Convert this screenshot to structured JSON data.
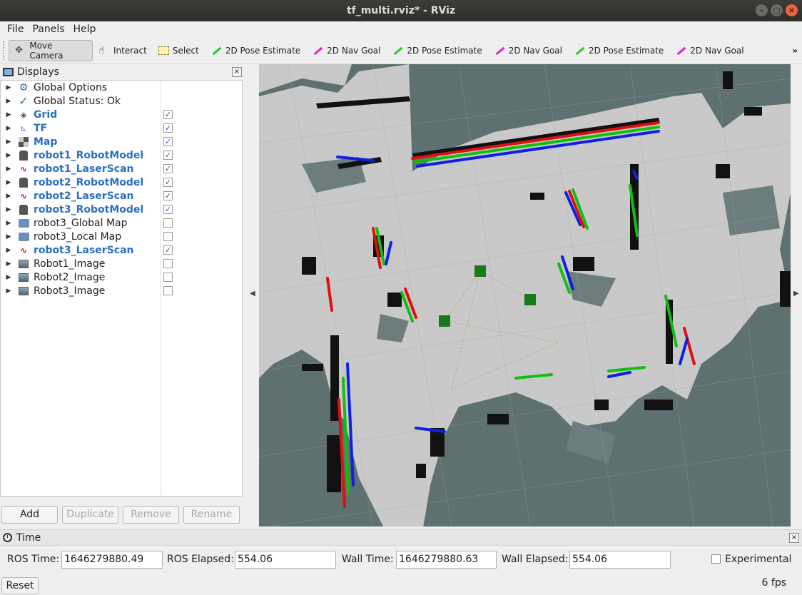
{
  "window": {
    "title": "tf_multi.rviz* - RViz"
  },
  "menu": {
    "file": "File",
    "panels": "Panels",
    "help": "Help"
  },
  "toolbar": {
    "tools": [
      {
        "label": "Move Camera",
        "icon": "move-camera-icon",
        "active": true
      },
      {
        "label": "Interact",
        "icon": "hand-icon"
      },
      {
        "label": "Select",
        "icon": "select-icon"
      },
      {
        "label": "2D Pose Estimate",
        "icon": "green-arrow-icon"
      },
      {
        "label": "2D Nav Goal",
        "icon": "magenta-arrow-icon"
      },
      {
        "label": "2D Pose Estimate",
        "icon": "green-arrow-icon"
      },
      {
        "label": "2D Nav Goal",
        "icon": "magenta-arrow-icon"
      },
      {
        "label": "2D Pose Estimate",
        "icon": "green-arrow-icon"
      },
      {
        "label": "2D Nav Goal",
        "icon": "magenta-arrow-icon"
      }
    ],
    "overflow": "»"
  },
  "displays": {
    "title": "Displays",
    "items": [
      {
        "label": "Global Options",
        "icon": "gear-icon",
        "checked": null,
        "highlight": false
      },
      {
        "label": "Global Status: Ok",
        "icon": "check-icon",
        "checked": null,
        "highlight": false
      },
      {
        "label": "Grid",
        "icon": "grid-icon",
        "checked": true,
        "highlight": true
      },
      {
        "label": "TF",
        "icon": "tf-icon",
        "checked": true,
        "highlight": true
      },
      {
        "label": "Map",
        "icon": "map-icon",
        "checked": true,
        "highlight": true
      },
      {
        "label": "robot1_RobotModel",
        "icon": "robot-icon",
        "checked": true,
        "highlight": true
      },
      {
        "label": "robot1_LaserScan",
        "icon": "laser-icon",
        "checked": true,
        "highlight": true
      },
      {
        "label": "robot2_RobotModel",
        "icon": "robot-icon",
        "checked": true,
        "highlight": true
      },
      {
        "label": "robot2_LaserScan",
        "icon": "laser-icon",
        "checked": true,
        "highlight": true
      },
      {
        "label": "robot3_RobotModel",
        "icon": "robot-icon",
        "checked": true,
        "highlight": true
      },
      {
        "label": "robot3_Global Map",
        "icon": "folder-icon",
        "checked": false,
        "highlight": false
      },
      {
        "label": "robot3_Local Map",
        "icon": "folder-icon",
        "checked": false,
        "highlight": false
      },
      {
        "label": "robot3_LaserScan",
        "icon": "laser-icon",
        "checked": true,
        "highlight": true
      },
      {
        "label": "Robot1_Image",
        "icon": "image-icon",
        "checked": false,
        "highlight": false
      },
      {
        "label": "Robot2_Image",
        "icon": "image-icon",
        "checked": false,
        "highlight": false
      },
      {
        "label": "Robot3_Image",
        "icon": "image-icon",
        "checked": false,
        "highlight": false
      }
    ],
    "buttons": {
      "add": "Add",
      "duplicate": "Duplicate",
      "remove": "Remove",
      "rename": "Rename"
    }
  },
  "time": {
    "title": "Time",
    "ros_time_label": "ROS Time:",
    "ros_time": "1646279880.49",
    "ros_elapsed_label": "ROS Elapsed:",
    "ros_elapsed": "554.06",
    "wall_time_label": "Wall Time:",
    "wall_time": "1646279880.63",
    "wall_elapsed_label": "Wall Elapsed:",
    "wall_elapsed": "554.06",
    "experimental_label": "Experimental",
    "reset": "Reset",
    "fps": "6 fps"
  },
  "colors": {
    "viewport_bg": "#5f7070",
    "free_space": "#c8c8c8",
    "obstacle": "#111111",
    "scan_red": "#e01010",
    "scan_green": "#10c010",
    "scan_blue": "#1020e0",
    "highlight_text": "#2a6fc2"
  }
}
